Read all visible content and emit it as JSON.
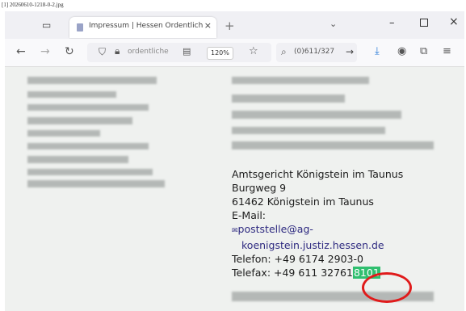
{
  "caption": "[1] 20260610-1218-0-2.jpg",
  "browser": {
    "tab": {
      "title": "Impressum | Hessen Ordentlich"
    },
    "tab_close_glyph": "×",
    "new_tab_glyph": "+",
    "url_text": "ordentliche",
    "zoom_level": "120%",
    "search_text": "(0)611/327",
    "icons": [
      "tab-list-icon",
      "back-icon",
      "forward-icon",
      "reload-icon",
      "shield-icon",
      "lock-icon",
      "reader-icon",
      "bookmark-star-icon",
      "search-icon",
      "go-arrow-icon",
      "download-icon",
      "account-icon",
      "extensions-icon",
      "menu-icon"
    ]
  },
  "address": {
    "court": "Amtsgericht Königstein im Taunus",
    "street": "Burgweg 9",
    "city": "61462 Königstein im Taunus",
    "email_label": "E-Mail:",
    "email_part1": "poststelle@ag-",
    "email_part2": "koenigstein.justiz.hessen.de",
    "phone": "Telefon: +49 6174 2903-0",
    "fax_prefix": "Telefax: +49 611 32761",
    "fax_highlight": "8101"
  },
  "colors": {
    "highlight": "#2fbf6f",
    "circle": "#e01b1b",
    "link": "#2e2a80"
  }
}
